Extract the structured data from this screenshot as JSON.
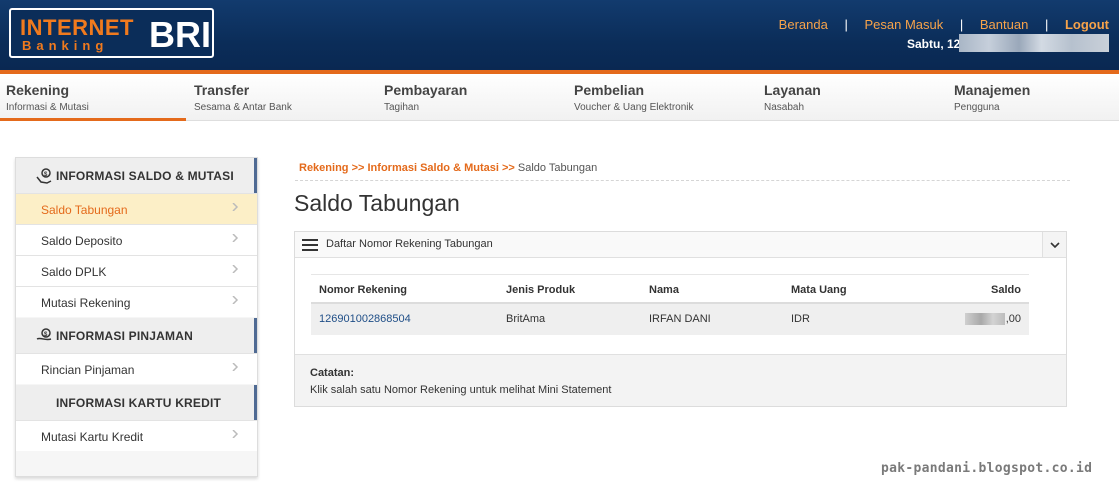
{
  "header": {
    "logo": {
      "line1": "INTERNET",
      "line2": "Banking",
      "brand": "BRI"
    },
    "nav": [
      {
        "label": "Beranda"
      },
      {
        "label": "Pesan Masuk"
      },
      {
        "label": "Bantuan"
      },
      {
        "label": "Logout"
      }
    ],
    "separator": "|",
    "date_prefix": "Sabtu, 12"
  },
  "menu": [
    {
      "title": "Rekening",
      "subtitle": "Informasi & Mutasi"
    },
    {
      "title": "Transfer",
      "subtitle": "Sesama & Antar Bank"
    },
    {
      "title": "Pembayaran",
      "subtitle": "Tagihan"
    },
    {
      "title": "Pembelian",
      "subtitle": "Voucher & Uang Elektronik"
    },
    {
      "title": "Layanan",
      "subtitle": "Nasabah"
    },
    {
      "title": "Manajemen",
      "subtitle": "Pengguna"
    }
  ],
  "sidebar": {
    "sections": [
      {
        "title": "INFORMASI SALDO & MUTASI",
        "icon": "money-hand-icon",
        "items": [
          "Saldo Tabungan",
          "Saldo Deposito",
          "Saldo DPLK",
          "Mutasi Rekening"
        ]
      },
      {
        "title": "INFORMASI PINJAMAN",
        "icon": "loan-hand-icon",
        "items": [
          "Rincian Pinjaman"
        ]
      },
      {
        "title": "INFORMASI KARTU KREDIT",
        "icon": "",
        "items": [
          "Mutasi Kartu Kredit"
        ]
      }
    ],
    "active_item": "Saldo Tabungan"
  },
  "breadcrumb": {
    "part1": "Rekening",
    "sep": ">>",
    "part2": "Informasi Saldo & Mutasi",
    "current": "Saldo Tabungan"
  },
  "page_title": "Saldo Tabungan",
  "panel": {
    "title": "Daftar Nomor Rekening Tabungan",
    "table": {
      "headers": [
        "Nomor Rekening",
        "Jenis Produk",
        "Nama",
        "Mata Uang",
        "Saldo"
      ],
      "rows": [
        {
          "nomor": "126901002868504",
          "jenis": "BritAma",
          "nama": "IRFAN DANI",
          "mata_uang": "IDR",
          "saldo_suffix": ",00"
        }
      ]
    },
    "note_title": "Catatan:",
    "note_body": "Klik salah satu Nomor Rekening untuk melihat Mini Statement"
  },
  "watermark": "pak-pandani.blogspot.co.id",
  "colors": {
    "navy": "#0b2d59",
    "orange": "#e46a1b",
    "link_orange": "#f7a34a",
    "account_link": "#1f4e87"
  }
}
